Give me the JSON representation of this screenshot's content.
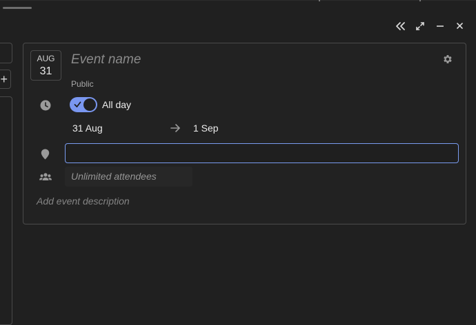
{
  "window": {
    "controls": [
      {
        "name": "collapse",
        "icon": "double-chevron-left-icon"
      },
      {
        "name": "expand",
        "icon": "expand-arrows-icon"
      },
      {
        "name": "minimize",
        "icon": "minimize-icon"
      },
      {
        "name": "close",
        "icon": "close-icon"
      }
    ]
  },
  "sidebar": {
    "add_label": "+"
  },
  "event": {
    "date_badge": {
      "month": "AUG",
      "day": "31"
    },
    "name_placeholder": "Event name",
    "visibility": "Public",
    "all_day": {
      "enabled": true,
      "label": "All day"
    },
    "start_date": "31 Aug",
    "end_date": "1 Sep",
    "location_value": "",
    "attendees_placeholder": "Unlimited attendees",
    "description_placeholder": "Add event description"
  },
  "colors": {
    "background": "#202020",
    "accent": "#7a97f0",
    "border": "#4b4b4b"
  }
}
